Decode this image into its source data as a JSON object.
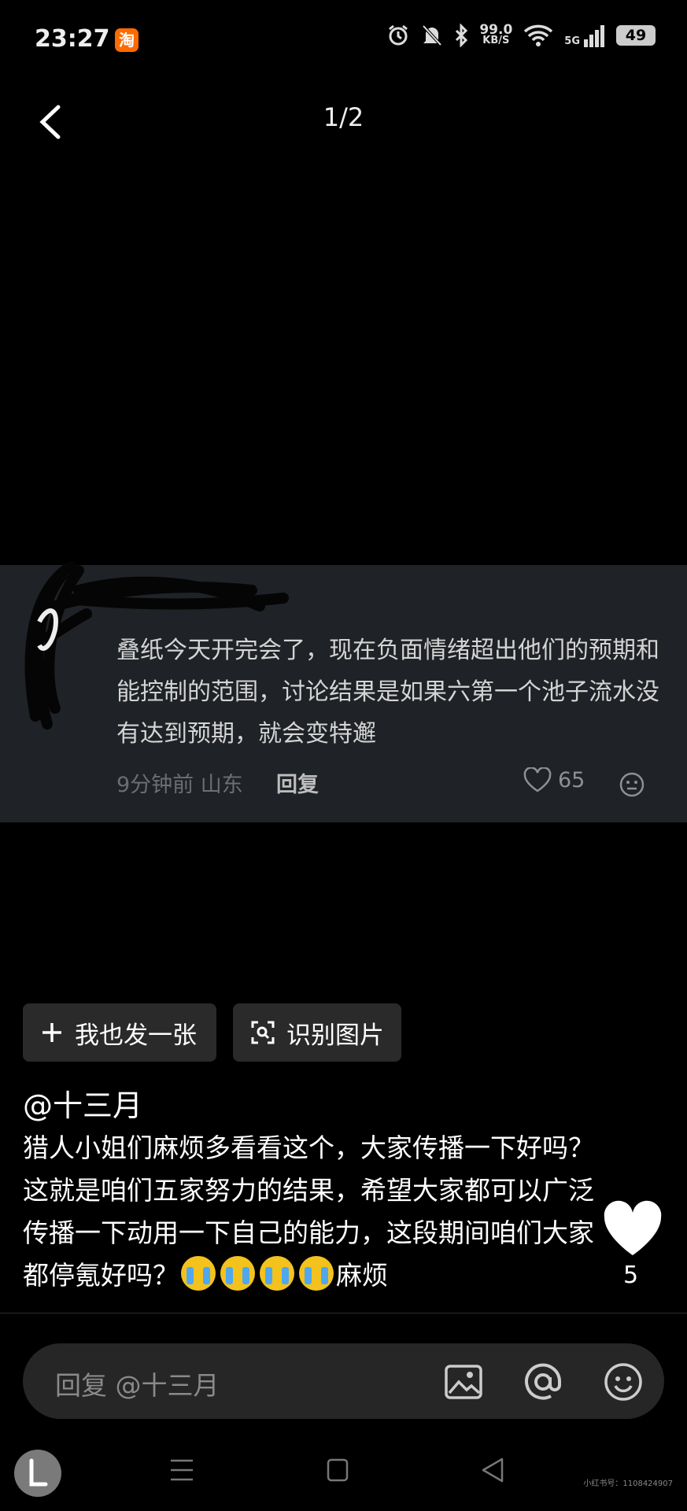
{
  "status_bar": {
    "time": "23:27",
    "app_badge": "淘",
    "net_speed_value": "99.0",
    "net_speed_unit": "KB/S",
    "signal": "5G",
    "battery": "49"
  },
  "header": {
    "counter": "1/2"
  },
  "image_comment": {
    "text": "叠纸今天开完会了，现在负面情绪超出他们的预期和能控制的范围，讨论结果是如果六第一个池子流水没有达到预期，就会变特邂",
    "time_location": "9分钟前 山东",
    "reply_label": "回复",
    "like_count": "65"
  },
  "actions": {
    "post_label": "我也发一张",
    "recognize_label": "识别图片"
  },
  "post": {
    "author": "@十三月",
    "body_main": "猎人小姐们麻烦多看看这个，大家传播一下好吗？这就是咱们五家努力的结果，希望大家都可以广泛传播一下动用一下自己的能力，这段期间咱们大家都停氪好吗？",
    "emoji_name": "loudly-crying-face",
    "emoji_count": 4,
    "body_tail": "麻烦",
    "like_count": "5"
  },
  "reply_bar": {
    "placeholder": "回复 @十三月"
  },
  "watermark": "小红书号：1108424907",
  "colors": {
    "background": "#000000",
    "card": "#1f2226",
    "reply_bar": "#262626",
    "button": "#2a2a2a"
  }
}
